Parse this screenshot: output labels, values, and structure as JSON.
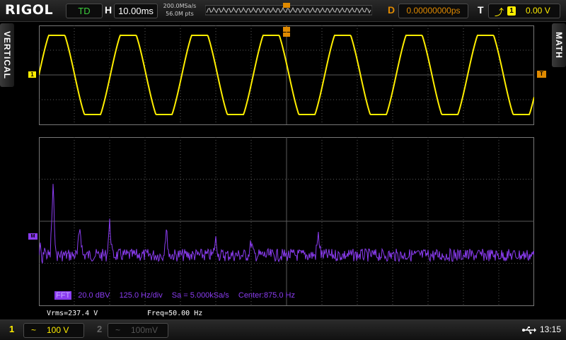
{
  "topbar": {
    "brand": "RIGOL",
    "run_state": "TD",
    "h_label": "H",
    "timebase": "10.00ms",
    "sample_rate": "200.0MSa/s",
    "memory_depth": "56.0M pts",
    "d_label": "D",
    "delay": "0.00000000ps",
    "t_label": "T",
    "trigger_source": "1",
    "trigger_level": "0.00 V"
  },
  "side_tabs": {
    "vertical": "VERTICAL",
    "math": "MATH"
  },
  "markers": {
    "ch1": "1",
    "trigger_position": "T",
    "trigger_level": "T",
    "math": "M"
  },
  "fft": {
    "label": "FFT",
    "scale": "20.0 dBV",
    "hz_div": "125.0 Hz/div",
    "sample": "Sa = 5.000kSa/s",
    "center": "Center:875.0 Hz"
  },
  "measurements": {
    "vrms": "Vrms=237.4 V",
    "freq": "Freq=50.00 Hz"
  },
  "bottombar": {
    "ch1": {
      "num": "1",
      "coupling": "~",
      "scale": "100 V"
    },
    "ch2": {
      "num": "2",
      "coupling": "~",
      "scale": "100mV"
    },
    "time": "13:15"
  },
  "colors": {
    "ch1": "#ffee00",
    "math": "#8a3cf0",
    "trigger": "#e08a00",
    "grid": "#5a5a5a"
  }
}
